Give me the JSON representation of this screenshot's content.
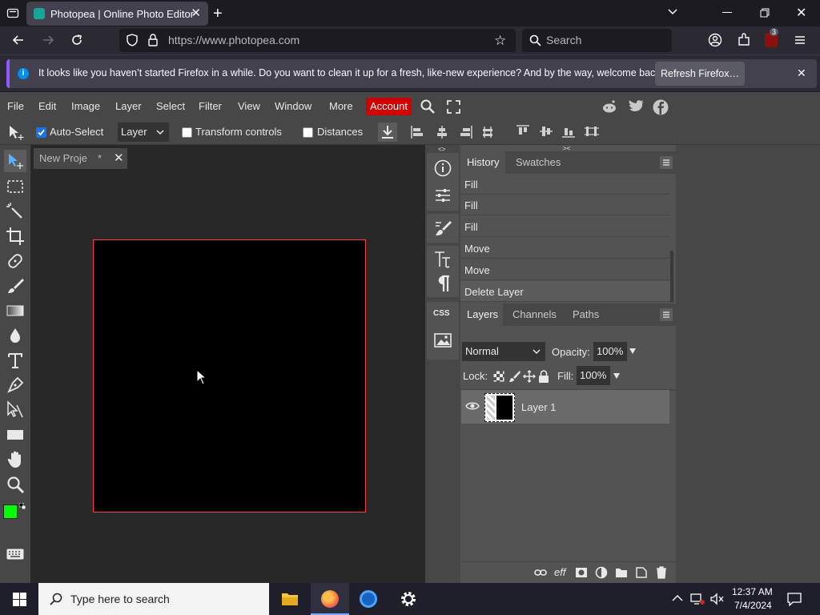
{
  "browser": {
    "tab_title": "Photopea | Online Photo Editor",
    "url": "https://www.photopea.com",
    "search_placeholder": "Search",
    "extension_badge": "3",
    "notification": {
      "message": "It looks like you haven’t started Firefox in a while. Do you want to clean it up for a fresh, like-new experience? And by the way, welcome back!",
      "button": "Refresh Firefox…"
    }
  },
  "photopea": {
    "menu": [
      "File",
      "Edit",
      "Image",
      "Layer",
      "Select",
      "Filter",
      "View",
      "Window",
      "More"
    ],
    "account_label": "Account",
    "options": {
      "auto_select_label": "Auto-Select",
      "auto_select_checked": true,
      "target": "Layer",
      "transform_label": "Transform controls",
      "distances_label": "Distances"
    },
    "document_tab": "New Proje",
    "document_modified": "*",
    "history_tabs": [
      "History",
      "Swatches"
    ],
    "history": [
      "Fill",
      "Fill",
      "Fill",
      "Move",
      "Move",
      "Delete Layer"
    ],
    "layers_tabs": [
      "Layers",
      "Channels",
      "Paths"
    ],
    "blend_mode": "Normal",
    "opacity_label": "Opacity:",
    "opacity": "100%",
    "lock_label": "Lock:",
    "fill_label": "Fill:",
    "fill": "100%",
    "layers": [
      {
        "name": "Layer 1"
      }
    ],
    "foreground_color": "#00ff00",
    "background_color": "#ffffff",
    "canvas_color": "#000000",
    "footer_fx": "eff"
  },
  "taskbar": {
    "search_placeholder": "Type here to search",
    "time": "12:37 AM",
    "date": "7/4/2024"
  }
}
